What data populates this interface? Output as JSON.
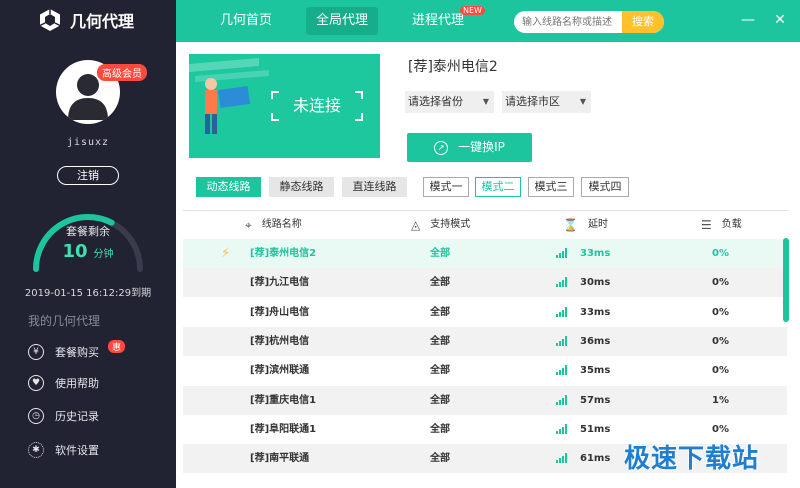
{
  "app": {
    "name": "几何代理"
  },
  "user": {
    "vip_label": "高级会员",
    "username": "jisuxz",
    "logout_label": "注销"
  },
  "plan": {
    "label": "套餐剩余",
    "remaining": "10",
    "unit": "分钟",
    "remaining_fraction": 0.65,
    "expire": "2019-01-15  16:12:29到期"
  },
  "sidebar": {
    "section_title": "我的几何代理",
    "hot_badge": "惠",
    "items": [
      {
        "label": "套餐购买",
        "icon": "yuan-icon"
      },
      {
        "label": "使用帮助",
        "icon": "heart-icon"
      },
      {
        "label": "历史记录",
        "icon": "clock-icon"
      },
      {
        "label": "软件设置",
        "icon": "gear-icon"
      }
    ]
  },
  "nav": {
    "tabs": [
      {
        "label": "几何首页"
      },
      {
        "label": "全局代理"
      },
      {
        "label": "进程代理"
      }
    ],
    "new_badge": "NEW",
    "search_placeholder": "输入线路名称或描述",
    "search_button": "搜索",
    "minimize": "—",
    "close": "✕"
  },
  "status": {
    "connection": "未连接",
    "current_line": "[荐]泰州电信2",
    "province_select": "请选择省份",
    "city_select": "请选择市区",
    "switch_ip": "一键换IP"
  },
  "line_types": [
    "动态线路",
    "静态线路",
    "直连线路"
  ],
  "modes": [
    "模式一",
    "模式二",
    "模式三",
    "模式四"
  ],
  "table": {
    "headers": {
      "name": "线路名称",
      "mode": "支持模式",
      "latency": "延时",
      "load": "负载"
    },
    "rows": [
      {
        "name": "[荐]泰州电信2",
        "mode": "全部",
        "latency": "33ms",
        "load": "0%"
      },
      {
        "name": "[荐]九江电信",
        "mode": "全部",
        "latency": "30ms",
        "load": "0%"
      },
      {
        "name": "[荐]舟山电信",
        "mode": "全部",
        "latency": "33ms",
        "load": "0%"
      },
      {
        "name": "[荐]杭州电信",
        "mode": "全部",
        "latency": "36ms",
        "load": "0%"
      },
      {
        "name": "[荐]滨州联通",
        "mode": "全部",
        "latency": "35ms",
        "load": "0%"
      },
      {
        "name": "[荐]重庆电信1",
        "mode": "全部",
        "latency": "57ms",
        "load": "1%"
      },
      {
        "name": "[荐]阜阳联通1",
        "mode": "全部",
        "latency": "51ms",
        "load": "0%"
      },
      {
        "name": "[荐]南平联通",
        "mode": "全部",
        "latency": "61ms",
        "load": "1%"
      }
    ]
  },
  "watermark": "极速下载站",
  "colors": {
    "accent": "#1cc59e",
    "sidebar": "#212232",
    "badge": "#ff4a3d",
    "search_button": "#ffc12a"
  }
}
